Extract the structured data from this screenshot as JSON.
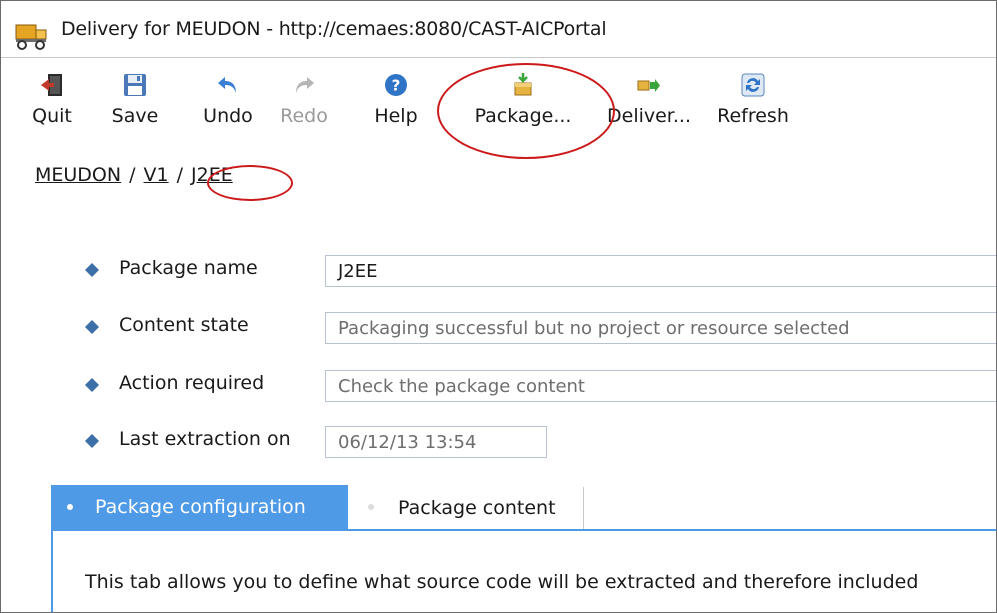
{
  "window": {
    "title": "Delivery for MEUDON - http://cemaes:8080/CAST-AICPortal",
    "icon": "delivery-truck-icon"
  },
  "toolbar": {
    "quit": {
      "label": "Quit",
      "icon": "quit-door-icon"
    },
    "save": {
      "label": "Save",
      "icon": "floppy-disk-icon"
    },
    "undo": {
      "label": "Undo",
      "icon": "undo-arrow-icon"
    },
    "redo": {
      "label": "Redo",
      "icon": "redo-arrow-icon",
      "disabled": true
    },
    "help": {
      "label": "Help",
      "icon": "help-question-icon"
    },
    "package": {
      "label": "Package...",
      "icon": "package-box-icon"
    },
    "deliver": {
      "label": "Deliver...",
      "icon": "deliver-arrow-icon"
    },
    "refresh": {
      "label": "Refresh",
      "icon": "refresh-icon"
    }
  },
  "breadcrumb": {
    "items": [
      "MEUDON",
      "V1",
      "J2EE"
    ],
    "separator": "/"
  },
  "form": {
    "package_name": {
      "label": "Package name",
      "value": "J2EE"
    },
    "content_state": {
      "label": "Content state",
      "value": "Packaging successful but no project or resource selected"
    },
    "action_required": {
      "label": "Action required",
      "value": "Check the package content"
    },
    "last_extraction": {
      "label": "Last extraction on",
      "value": "06/12/13 13:54"
    }
  },
  "tabs": [
    {
      "label": "Package configuration",
      "active": true
    },
    {
      "label": "Package content",
      "active": false
    }
  ],
  "tab_panel": {
    "text": "This tab allows you to define what source code will be extracted and therefore included"
  },
  "colors": {
    "accent_blue": "#4e9ae6",
    "annotation_red": "#cc1a1a"
  }
}
